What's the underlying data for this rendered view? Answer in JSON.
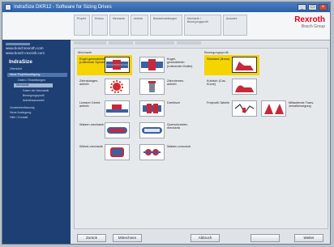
{
  "window": {
    "title": "IndraSize DKR12 - Software for Sizing Drives"
  },
  "header": {
    "tabs": [
      "Projekt",
      "Einbau",
      "Mechanik",
      "Antrieb"
    ],
    "sub_tabs": [
      "Basiseinstellungen",
      "Mechanik / Bewegungsprofil",
      "Auswahl"
    ],
    "logo_main": "Rexroth",
    "logo_sub": "Bosch Group"
  },
  "sidebar": {
    "link1": "www.boschrexroth.com",
    "link2": "www.bosch-rexroth.com",
    "title": "IndraSize",
    "items": [
      "Übersicht",
      "Neue Projektauslegung",
      "Daten / Einstellungen",
      "Mechanik",
      "Daten der Mechanik",
      "Bewegungsprofil",
      "Antriebsauswahl",
      "Zusammenfassung",
      "Neue Auslegung",
      "Hilfe / Kontakt"
    ]
  },
  "mechanics": {
    "title": "Mechanik",
    "left": [
      {
        "label": "Kugel-gewindetrieb (rotierende Spindel)",
        "selected": true
      },
      {
        "label": "Zahnstangen-antrieb",
        "selected": false
      },
      {
        "label": "Linearer Direkt-antrieb",
        "selected": false
      },
      {
        "label": "Walzen-mechanik",
        "selected": false
      },
      {
        "label": "Wickel-mechanik",
        "selected": false
      }
    ],
    "right": [
      {
        "label": "Kugel-gewindetrieb (rotierende Mutter)"
      },
      {
        "label": "Zahnriemen-antrieb"
      },
      {
        "label": "Drehtisch"
      },
      {
        "label": "Querschneider-mechanik"
      },
      {
        "label": "Walzen-vorschub"
      }
    ]
  },
  "motion": {
    "title": "Bewegungsprofil",
    "items": [
      {
        "label": "Standard (linear)",
        "selected": true
      },
      {
        "label": "Kubisch (Cos-Kurve)",
        "selected": false
      },
      {
        "label": "Freiprofil-Tabelle",
        "selected": false
      }
    ],
    "extra_label": "Mitlaufende Trans-versalbewegung"
  },
  "buttons": {
    "back": "Zurück",
    "calc": "Mitrechnen",
    "cancel": "Abbruch",
    "disabled": "",
    "next": "Weiter"
  },
  "colors": {
    "accent": "#f5d400",
    "sidebar": "#1e3f73",
    "brand": "#e2001a"
  }
}
